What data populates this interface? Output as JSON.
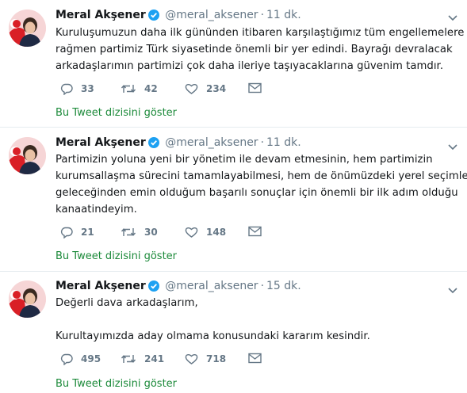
{
  "tweets": [
    {
      "name": "Meral Akşener",
      "handle": "@meral_aksener",
      "dot": "·",
      "time": "11 dk.",
      "lines": [
        "Kuruluşumuzun daha ilk gününden itibaren karşılaştığımız tüm engellemelere",
        "rağmen partimiz Türk siyasetinde önemli bir yer edindi. Bayrağı devralacak",
        "arkadaşlarımın partimizi çok daha ileriye taşıyacaklarına güvenim tamdır."
      ],
      "replies": "33",
      "retweets": "42",
      "likes": "234",
      "thread_link": "Bu Tweet dizisini göster"
    },
    {
      "name": "Meral Akşener",
      "handle": "@meral_aksener",
      "dot": "·",
      "time": "11 dk.",
      "lines": [
        "Partimizin yoluna yeni bir yönetim ile devam etmesinin, hem partimizin",
        "kurumsallaşma sürecini tamamlayabilmesi, hem de önümüzdeki yerel seçimlerde",
        "geleceğinden emin olduğum başarılı sonuçlar için önemli bir ilk adım olduğu",
        "kanaatindeyim."
      ],
      "replies": "21",
      "retweets": "30",
      "likes": "148",
      "thread_link": "Bu Tweet dizisini göster"
    },
    {
      "name": "Meral Akşener",
      "handle": "@meral_aksener",
      "dot": "·",
      "time": "15 dk.",
      "lines": [
        "Değerli dava arkadaşlarım,",
        "",
        "Kurultayımızda aday olmama konusundaki kararım kesindir."
      ],
      "replies": "495",
      "retweets": "241",
      "likes": "718",
      "thread_link": "Bu Tweet dizisini göster"
    }
  ],
  "icons": {
    "verified": "verified-badge-icon",
    "caret": "chevron-down-icon",
    "reply": "reply-icon",
    "retweet": "retweet-icon",
    "like": "heart-icon",
    "dm": "envelope-icon"
  },
  "colors": {
    "verified": "#1da1f2",
    "link": "#1c8a3a",
    "muted": "#657786",
    "divider": "#e6ecf0"
  }
}
